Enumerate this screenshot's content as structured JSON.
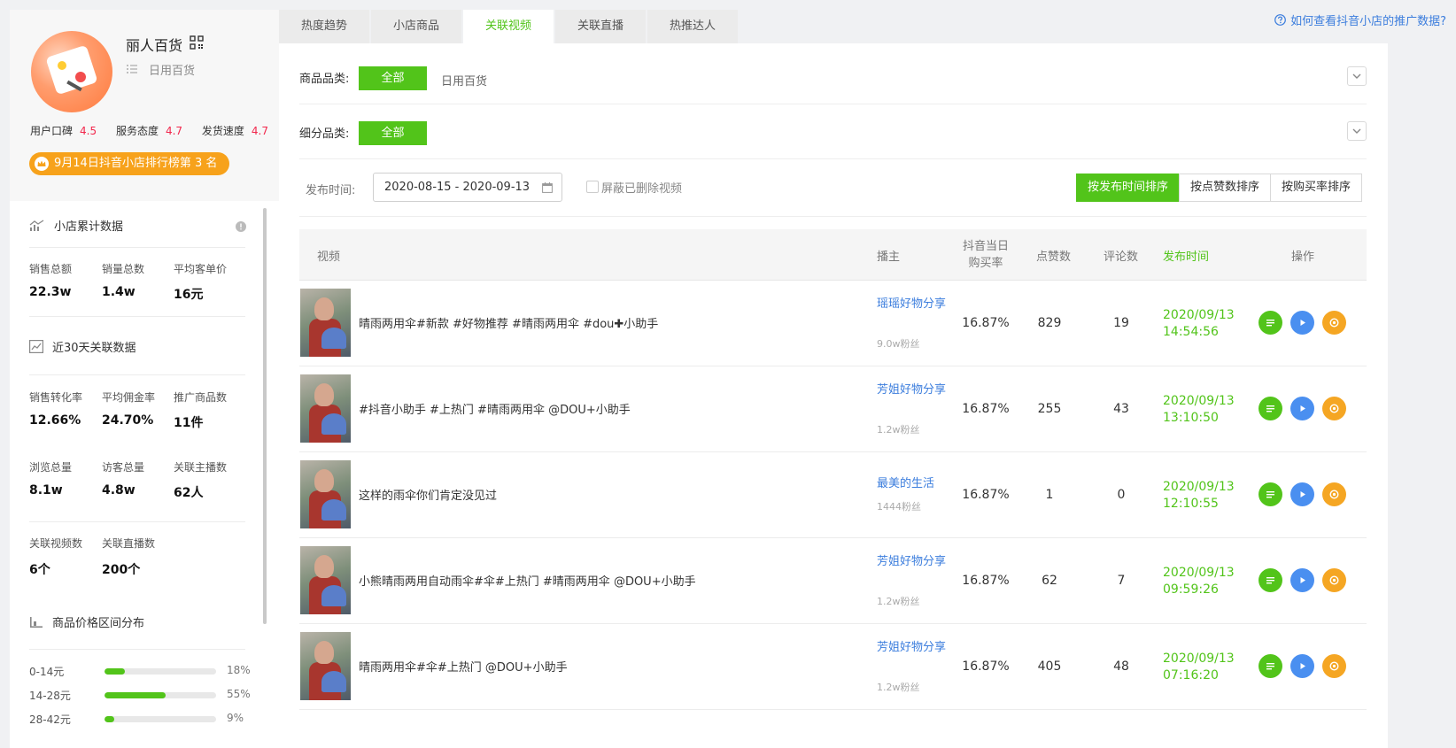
{
  "shop": {
    "name": "丽人百货",
    "category": "日用百货",
    "ratings": [
      {
        "label": "用户口碑",
        "value": "4.5"
      },
      {
        "label": "服务态度",
        "value": "4.7"
      },
      {
        "label": "发货速度",
        "value": "4.7"
      }
    ],
    "rank_badge": "9月14日抖音小店排行榜第 3 名"
  },
  "cumulative": {
    "title": "小店累计数据",
    "stats": [
      {
        "label": "销售总额",
        "value": "22.3w"
      },
      {
        "label": "销量总数",
        "value": "1.4w"
      },
      {
        "label": "平均客单价",
        "value": "16元"
      }
    ]
  },
  "recent30": {
    "title": "近30天关联数据",
    "stats_row1": [
      {
        "label": "销售转化率",
        "value": "12.66%"
      },
      {
        "label": "平均佣金率",
        "value": "24.70%"
      },
      {
        "label": "推广商品数",
        "value": "11件"
      }
    ],
    "stats_row2": [
      {
        "label": "浏览总量",
        "value": "8.1w"
      },
      {
        "label": "访客总量",
        "value": "4.8w"
      },
      {
        "label": "关联主播数",
        "value": "62人"
      }
    ],
    "stats_row3": [
      {
        "label": "关联视频数",
        "value": "6个"
      },
      {
        "label": "关联直播数",
        "value": "200个"
      }
    ]
  },
  "price_dist": {
    "title": "商品价格区间分布",
    "rows": [
      {
        "range": "0-14元",
        "pct": "18%",
        "fraction": 0.18
      },
      {
        "range": "14-28元",
        "pct": "55%",
        "fraction": 0.55
      },
      {
        "range": "28-42元",
        "pct": "9%",
        "fraction": 0.09
      }
    ]
  },
  "tabs": [
    "热度趋势",
    "小店商品",
    "关联视频",
    "关联直播",
    "热推达人"
  ],
  "active_tab": "关联视频",
  "help_link": "如何查看抖音小店的推广数据?",
  "filters": {
    "product_category_label": "商品品类:",
    "sub_category_label": "细分品类:",
    "all_label": "全部",
    "category_option": "日用百货",
    "date_label": "发布时间:",
    "date_range": "2020-08-15 - 2020-09-13",
    "hide_deleted": "屏蔽已删除视频"
  },
  "sort_buttons": [
    "按发布时间排序",
    "按点赞数排序",
    "按购买率排序"
  ],
  "table": {
    "headers": {
      "video": "视频",
      "anchor": "播主",
      "rate_line1": "抖音当日",
      "rate_line2": "购买率",
      "likes": "点赞数",
      "comments": "评论数",
      "time": "发布时间",
      "ops": "操作"
    },
    "rows": [
      {
        "title": "晴雨两用伞#新款 #好物推荐 #晴雨两用伞 #dou✚小助手",
        "anchor": "瑶瑶好物分享",
        "fans": "9.0w粉丝",
        "rate": "16.87%",
        "likes": "829",
        "comments": "19",
        "date": "2020/09/13",
        "time": "14:54:56"
      },
      {
        "title": "#抖音小助手 #上热门 #晴雨两用伞 @DOU+小助手",
        "anchor": "芳姐好物分享",
        "fans": "1.2w粉丝",
        "rate": "16.87%",
        "likes": "255",
        "comments": "43",
        "date": "2020/09/13",
        "time": "13:10:50"
      },
      {
        "title": "这样的雨伞你们肯定没见过",
        "anchor": "最美的生活",
        "fans": "1444粉丝",
        "rate": "16.87%",
        "likes": "1",
        "comments": "0",
        "date": "2020/09/13",
        "time": "12:10:55"
      },
      {
        "title": "小熊晴雨两用自动雨伞#伞#上热门 #晴雨两用伞 @DOU+小助手",
        "anchor": "芳姐好物分享",
        "fans": "1.2w粉丝",
        "rate": "16.87%",
        "likes": "62",
        "comments": "7",
        "date": "2020/09/13",
        "time": "09:59:26"
      },
      {
        "title": "晴雨两用伞#伞#上热门 @DOU+小助手",
        "anchor": "芳姐好物分享",
        "fans": "1.2w粉丝",
        "rate": "16.87%",
        "likes": "405",
        "comments": "48",
        "date": "2020/09/13",
        "time": "07:16:20"
      }
    ]
  },
  "colors": {
    "accent": "#52c41a",
    "link": "#3b7ddd",
    "badge": "#f7a21b",
    "rating": "#f2274c",
    "op_detail": "#52c41a",
    "op_play": "#4a8ff0",
    "op_locate": "#f5a623"
  }
}
